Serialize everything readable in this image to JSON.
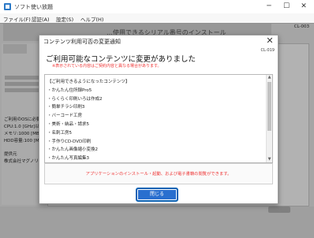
{
  "window": {
    "title": "ソフト使い放題",
    "minimize_glyph": "─",
    "maximize_glyph": "☐",
    "close_glyph": "✕"
  },
  "menu": [
    "ファイル(F)",
    "認証(A)",
    "設定(S)",
    "ヘルプ(H)"
  ],
  "background": {
    "screen_code": "CL-003",
    "header_text": "…使用できるシリアル番号のインストール",
    "specs": [
      "ご利用のOSに必要な",
      "CPU:1.0 [GHz]以上",
      "メモリ:1000 [MB]",
      "HDD容量:100 [MB]",
      "",
      "提供元",
      "株式会社マグノリア"
    ]
  },
  "dialog": {
    "title": "コンテンツ利用可否の変更通知",
    "screen_code": "CL-019",
    "heading": "ご利用可能なコンテンツに変更がありました",
    "note": "※表示されている内容はご契約内容と異なる場合があります。",
    "list": [
      "【ご利用できるようになったコンテンツ】",
      "・かんたん住所録Pro5",
      "・らくらく印刷いろは作成2",
      "・簡単チラシ印刷3",
      "・バーコード工房",
      "・美術・納品・請求5",
      "・名刺工房5",
      "・手作りCD-DVD印刷",
      "・かんたん画像縮小変換2",
      "・かんたん写真編集3"
    ],
    "warning": "アプリケーションのインストール・起動、および電子書籍の閲覧ができます。",
    "close_button": "閉じる",
    "close_glyph": "✕"
  },
  "icons": {
    "scroll_up": "▲",
    "scroll_down": "▼"
  },
  "colors": {
    "accent": "#2a6fcf",
    "warning_text": "#e33333",
    "app_icon": "#2b79c7"
  }
}
